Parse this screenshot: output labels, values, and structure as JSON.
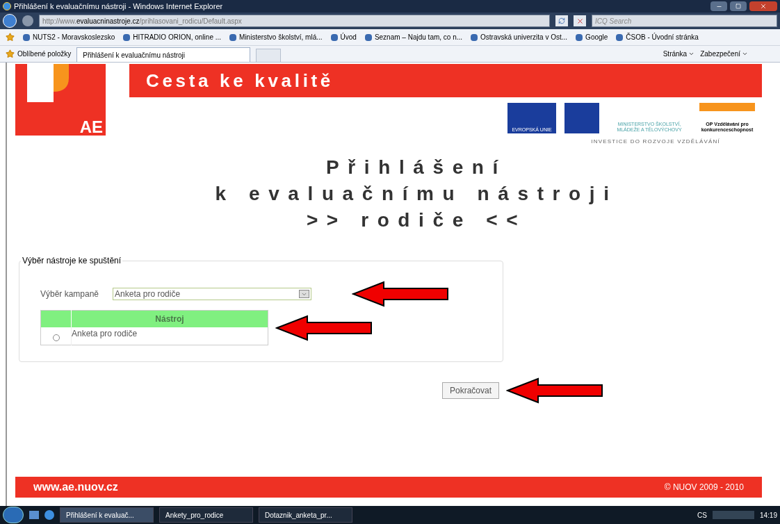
{
  "window": {
    "title": "Přihlášení k evaluačnímu nástroji - Windows Internet Explorer"
  },
  "address_bar": {
    "url_prefix": "http://www.",
    "url_domain": "evaluacninastroje.cz",
    "url_path": "/prihlasovani_rodicu/Default.aspx",
    "search_placeholder": "ICQ Search"
  },
  "links": [
    "NUTS2 - Moravskoslezsko",
    "HITRADIO ORION, online ...",
    "Ministerstvo školství, mlá...",
    "Úvod",
    "Seznam – Najdu tam, co n...",
    "Ostravská univerzita v Ost...",
    "Google",
    "ČSOB - Úvodní stránka"
  ],
  "favorites_label": "Oblíbené položky",
  "tabs": [
    {
      "label": "Přihlášení k evaluačnímu nástroji",
      "selected": true
    }
  ],
  "command_bar": [
    "Stránka",
    "Zabezpečení"
  ],
  "page": {
    "logo_text": "AE",
    "banner": "Cesta ke kvalitě",
    "partner_labels": [
      "EVROPSKÁ UNIE",
      "MINISTERSTVO ŠKOLSTVÍ, MLÁDEŽE A TĚLOVÝCHOVY",
      "OP Vzdělávání pro konkurenceschopnost"
    ],
    "partner_tagline": "INVESTICE DO ROZVOJE VZDĚLÁVÁNÍ",
    "heading": [
      "Přihlášení",
      "k evaluačnímu nástroji",
      ">> rodiče <<"
    ],
    "fieldset": {
      "legend": "Výběr nástroje ke spuštění",
      "campaign_label": "Výběr kampaně",
      "campaign_value": "Anketa pro rodiče",
      "table": {
        "columns": [
          "Nástroj"
        ],
        "rows": [
          {
            "name": "Anketa pro rodiče",
            "selected": false
          }
        ]
      }
    },
    "continue_button": "Pokračovat",
    "footer": {
      "site": "www.ae.nuov.cz",
      "copyright": "© NUOV 2009 - 2010"
    }
  },
  "taskbar": {
    "tasks": [
      {
        "label": "Přihlášení k evaluač...",
        "selected": true
      },
      {
        "label": "Ankety_pro_rodice",
        "selected": false
      },
      {
        "label": "Dotaznik_anketa_pr...",
        "selected": false
      }
    ],
    "language": "CS",
    "clock": "14:19"
  }
}
